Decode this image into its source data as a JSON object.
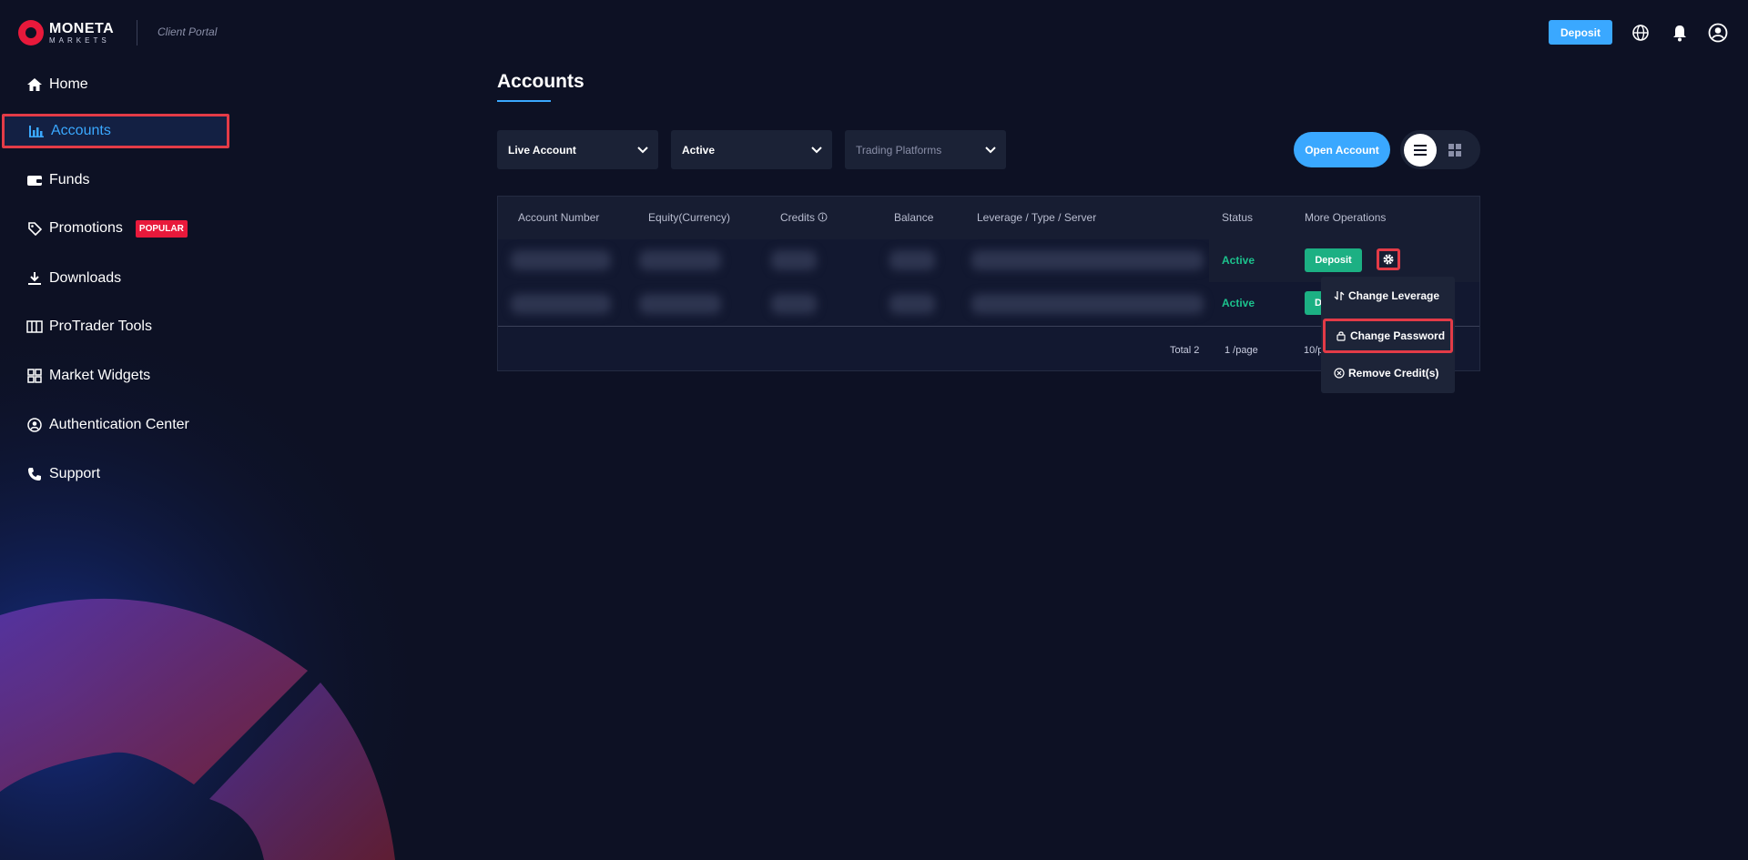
{
  "header": {
    "brand": "MONETA",
    "brand_sub": "MARKETS",
    "portal_label": "Client Portal",
    "deposit_label": "Deposit",
    "icons": [
      "globe-icon",
      "bell-icon",
      "user-icon"
    ]
  },
  "sidebar": {
    "items": [
      {
        "label": "Home",
        "icon": "home-icon"
      },
      {
        "label": "Accounts",
        "icon": "bar-chart-icon",
        "active": true
      },
      {
        "label": "Funds",
        "icon": "wallet-icon"
      },
      {
        "label": "Promotions",
        "icon": "tag-icon",
        "badge": "POPULAR"
      },
      {
        "label": "Downloads",
        "icon": "download-icon"
      },
      {
        "label": "ProTrader Tools",
        "icon": "chart-tool-icon"
      },
      {
        "label": "Market Widgets",
        "icon": "widgets-icon"
      },
      {
        "label": "Authentication Center",
        "icon": "user-circle-icon"
      },
      {
        "label": "Support",
        "icon": "phone-icon"
      }
    ]
  },
  "main": {
    "title": "Accounts",
    "filters": {
      "account_type": "Live Account",
      "status": "Active",
      "platform_placeholder": "Trading Platforms"
    },
    "open_account_label": "Open Account",
    "table": {
      "columns": [
        "Account Number",
        "Equity(Currency)",
        "Credits",
        "Balance",
        "Leverage / Type / Server",
        "Status",
        "More Operations"
      ],
      "rows": [
        {
          "status": "Active",
          "action": "Deposit"
        },
        {
          "status": "Active",
          "action": "D"
        }
      ],
      "footer": {
        "total": "Total 2",
        "page": "1 /page",
        "page_size": "10/p"
      }
    },
    "operations_menu": {
      "items": [
        {
          "label": "Change Leverage",
          "icon": "swap-vertical-icon"
        },
        {
          "label": "Change Password",
          "icon": "lock-icon",
          "highlighted": true
        },
        {
          "label": "Remove Credit(s)",
          "icon": "remove-circle-icon"
        }
      ]
    }
  },
  "colors": {
    "background": "#0d1124",
    "accent": "#3aa8ff",
    "brand_red": "#e8193b",
    "status_green": "#1cc28d",
    "highlight_border": "#e33b47"
  }
}
